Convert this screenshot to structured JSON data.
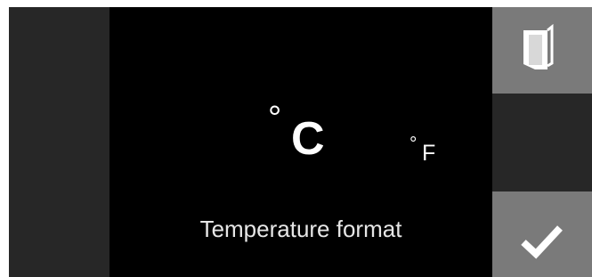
{
  "temperature_format": {
    "celsius": {
      "degree": "°",
      "letter": "C",
      "selected": true
    },
    "fahrenheit": {
      "degree": "°",
      "letter": "F",
      "selected": false
    },
    "label": "Temperature format"
  },
  "side_buttons": [
    {
      "icon": "exit-door-icon"
    },
    {
      "icon": ""
    },
    {
      "icon": "checkmark-icon"
    }
  ],
  "colors": {
    "screen_background": "#000000",
    "panel_background": "#272727",
    "button_background": "#7a7a7a",
    "text": "#ffffff",
    "icon": "#ffffff"
  }
}
